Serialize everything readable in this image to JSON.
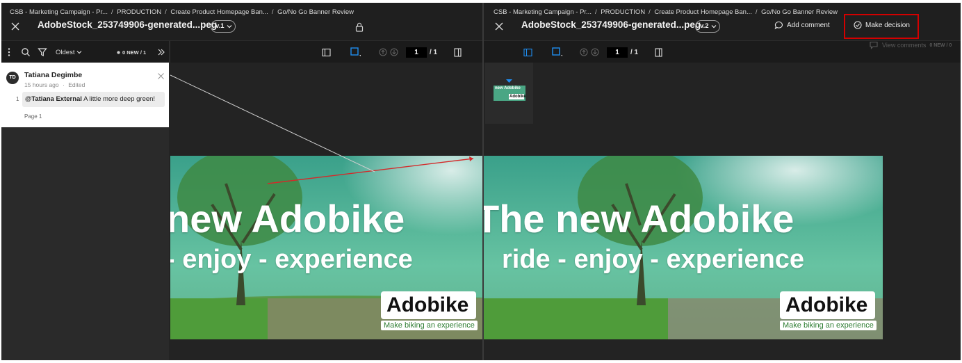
{
  "left": {
    "breadcrumb": [
      "CSB - Marketing Campaign - Pr...",
      "PRODUCTION",
      "Create Product Homepage Ban...",
      "Go/No Go Banner Review"
    ],
    "file_title": "AdobeStock_253749906-generated...peg",
    "version": "v.1",
    "toolbar": {
      "sort": "Oldest",
      "new_badge": "0 NEW / 1",
      "page": "1",
      "page_total": "/ 1"
    },
    "comment": {
      "avatar": "TD",
      "author": "Tatiana Degimbe",
      "time": "15 hours ago",
      "edited": "Edited",
      "number": "1",
      "mention": "@Tatiana External",
      "text": "A little more deep green!",
      "page": "Page 1"
    }
  },
  "right": {
    "breadcrumb": [
      "CSB - Marketing Campaign - Pr...",
      "PRODUCTION",
      "Create Product Homepage Ban...",
      "Go/No Go Banner Review"
    ],
    "file_title": "AdobeStock_253749906-generated...peg",
    "version": "v.2",
    "add_comment": "Add comment",
    "make_decision": "Make decision",
    "toolbar": {
      "page": "1",
      "page_total": "/ 1",
      "view_comments": "View comments",
      "new_badge": "0 NEW / 0"
    }
  },
  "banner": {
    "line1_left": "new Adobike",
    "line2_left": "- enjoy - experience",
    "line1_right": "The new Adobike",
    "line2_right": "ride - enjoy - experience",
    "logo": "Adobike",
    "tagline": "Make biking an experience",
    "thumb_line1": "new Adobike",
    "thumb_logo": "Adobike"
  },
  "colors": {
    "highlight": "#d40000",
    "annotation_arrow": "#d42a2a",
    "banner_green": "#3f9b7a"
  }
}
